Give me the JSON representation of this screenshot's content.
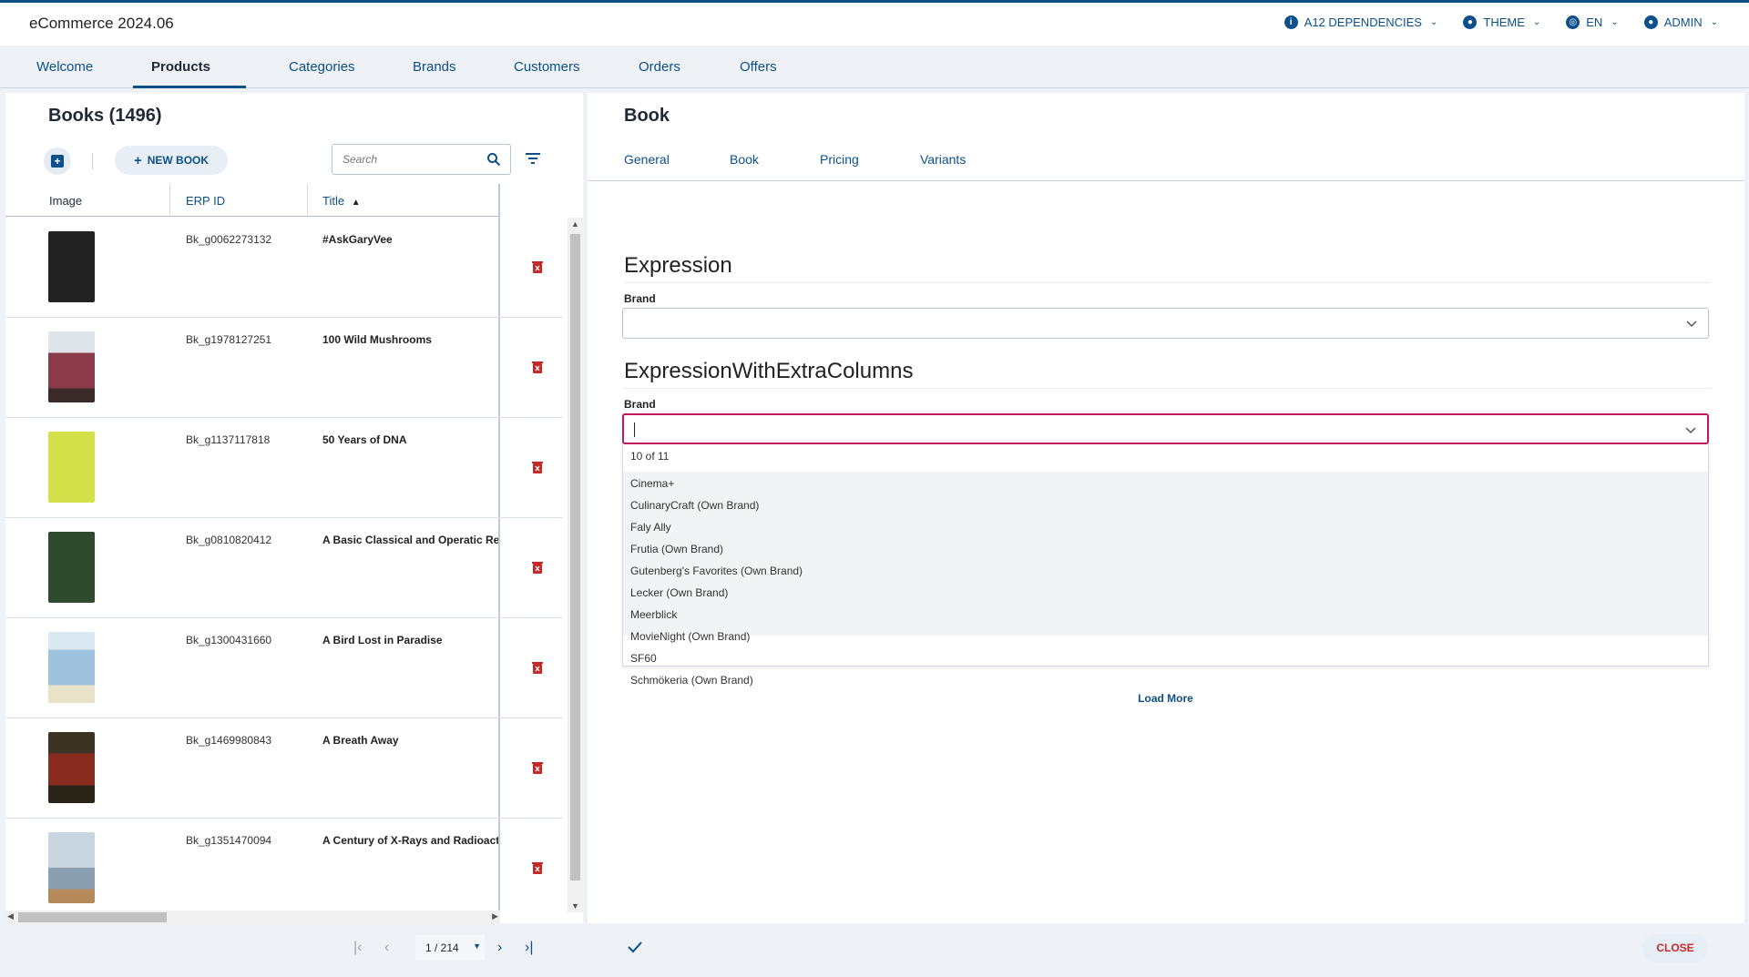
{
  "app": {
    "title": "eCommerce 2024.06"
  },
  "top_actions": {
    "dependencies": "A12 DEPENDENCIES",
    "theme": "THEME",
    "language": "EN",
    "user": "ADMIN"
  },
  "nav": {
    "items": [
      {
        "label": "Welcome"
      },
      {
        "label": "Products"
      },
      {
        "label": "Categories"
      },
      {
        "label": "Brands"
      },
      {
        "label": "Customers"
      },
      {
        "label": "Orders"
      },
      {
        "label": "Offers"
      }
    ],
    "active": "Products"
  },
  "list": {
    "title": "Books (1496)",
    "new_label": "NEW BOOK",
    "search_placeholder": "Search",
    "columns": {
      "image": "Image",
      "erp": "ERP ID",
      "title": "Title"
    },
    "rows": [
      {
        "erp": "Bk_g0062273132",
        "title": "#AskGaryVee",
        "thumb_color": "#222222"
      },
      {
        "erp": "Bk_g1978127251",
        "title": "100 Wild Mushrooms",
        "thumb_color": "#8b3a4a"
      },
      {
        "erp": "Bk_g1137117818",
        "title": "50 Years of DNA",
        "thumb_color": "#d4e04a"
      },
      {
        "erp": "Bk_g0810820412",
        "title": "A Basic Classical and Operatic Rec",
        "thumb_color": "#2f4a2f"
      },
      {
        "erp": "Bk_g1300431660",
        "title": "A Bird Lost in Paradise",
        "thumb_color": "#9fc3dd"
      },
      {
        "erp": "Bk_g1469980843",
        "title": "A Breath Away",
        "thumb_color": "#3b3324"
      },
      {
        "erp": "Bk_g1351470094",
        "title": "A Century of X-Rays and Radioact",
        "thumb_color": "#8aa0b0"
      }
    ],
    "pager": {
      "page": "1 / 214"
    }
  },
  "detail": {
    "title": "Book",
    "tabs": [
      "General",
      "Book",
      "Pricing",
      "Variants"
    ],
    "section1": {
      "heading": "Expression",
      "label": "Brand",
      "value": ""
    },
    "section2": {
      "heading": "ExpressionWithExtraColumns",
      "label": "Brand",
      "value": ""
    },
    "dropdown": {
      "count": "10 of 11",
      "options": [
        "Cinema+",
        "CulinaryCraft (Own Brand)",
        "Faly Ally",
        "Frutia (Own Brand)",
        "Gutenberg's Favorites (Own Brand)",
        "Lecker (Own Brand)",
        "Meerblick",
        "MovieNight (Own Brand)",
        "SF60",
        "Schmökeria (Own Brand)"
      ],
      "load_more": "Load More"
    },
    "close_label": "CLOSE"
  },
  "colors": {
    "primary": "#0c4f8a",
    "focus": "#c2185b",
    "danger": "#c62828"
  }
}
